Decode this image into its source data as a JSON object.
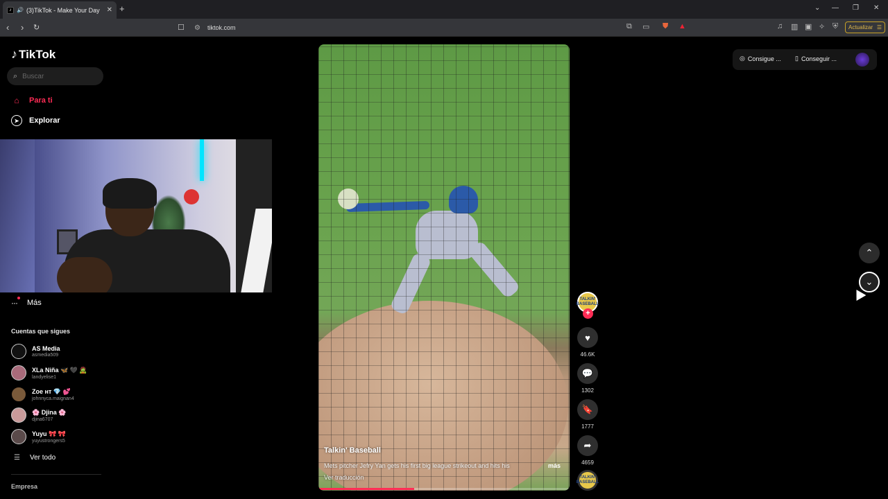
{
  "browser": {
    "tab_title": "(3)TikTok - Make Your Day",
    "tab_close": "✕",
    "new_tab": "+",
    "url": "tiktok.com",
    "update_button": "Actualizar",
    "window_controls": [
      "⌄",
      "—",
      "❐",
      "✕"
    ]
  },
  "sidebar": {
    "logo_text": "TikTok",
    "search_placeholder": "Buscar",
    "nav": [
      {
        "label": "Para ti",
        "icon": "home-icon",
        "active": true
      },
      {
        "label": "Explorar",
        "icon": "compass-icon",
        "active": false
      }
    ],
    "more_label": "Más",
    "following_heading": "Cuentas que sigues",
    "accounts": [
      {
        "name": "AS Media",
        "username": "asmedia509"
      },
      {
        "name": "XLa Niña 🦋 🖤 🧟",
        "username": "landyelise1"
      },
      {
        "name": "Zoe ʜᴛ 💎 💕",
        "username": "johnnyca.maignan4"
      },
      {
        "name": "🌸 Djina 🌸",
        "username": "djina6707"
      },
      {
        "name": "Yuyu 🎀 🎀",
        "username": "yuyustrongers5"
      }
    ],
    "see_all": "Ver todo",
    "company_heading": "Empresa"
  },
  "video": {
    "author": "Talkin' Baseball",
    "description": "Mets pitcher Jefry Yan gets his first big league strikeout and hits his",
    "more": "más",
    "translate": "Ver traducción",
    "progress": 0.38
  },
  "actions": {
    "creator_badge": "TALKIN' BASEBALL",
    "likes": "46.6K",
    "comments": "1302",
    "saves": "1777",
    "shares": "4659"
  },
  "topbar": {
    "get_coins": "Consigue ...",
    "get_app": "Conseguir ..."
  },
  "colors": {
    "accent": "#fe2c55",
    "update_gold": "#c9a227"
  }
}
